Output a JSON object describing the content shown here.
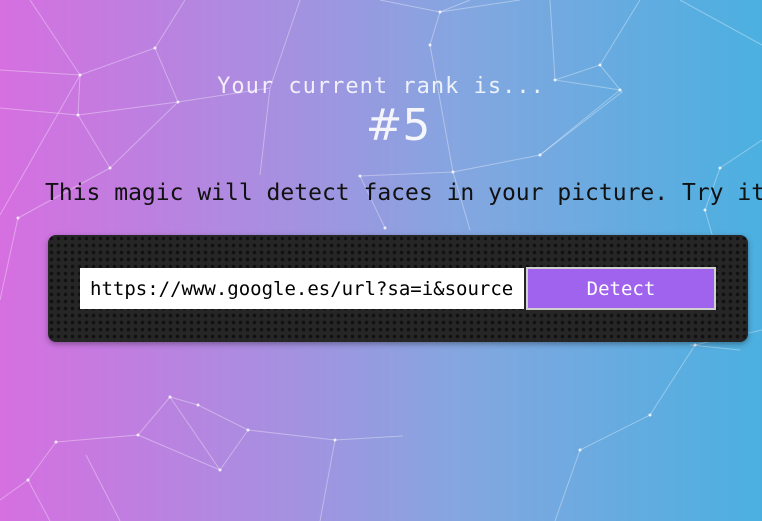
{
  "rank": {
    "label": "Your current rank is...",
    "value": "#5"
  },
  "tagline": "This magic will detect faces in your picture. Try it!",
  "detector": {
    "url_value": "https://www.google.es/url?sa=i&source=images",
    "detect_label": "Detect"
  },
  "colors": {
    "gradient_left": "#d66fe0",
    "gradient_right": "#4bb0e0",
    "button": "#a063ee",
    "panel": "#262626"
  }
}
